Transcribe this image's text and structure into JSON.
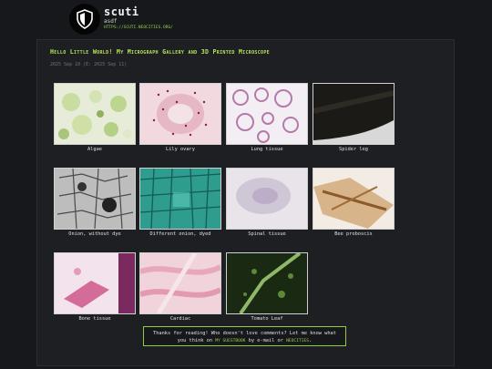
{
  "header": {
    "title": "scuti",
    "subtitle": "asdf",
    "url": "HTTPS://SCUTI.NEOCITIES.ORG/",
    "logo_icon": "shield-logo-icon"
  },
  "post": {
    "title": "Hello Little World! My Micrograph Gallery and 3D Printed Microscope",
    "date": "2025 Sep 10 (E: 2025 Sep 11)"
  },
  "gallery": [
    {
      "caption": "Algae",
      "image": "algae"
    },
    {
      "caption": "Lily ovary",
      "image": "lily-ovary"
    },
    {
      "caption": "Lung tissue",
      "image": "lung-tissue"
    },
    {
      "caption": "Spider leg",
      "image": "spider-leg"
    },
    {
      "caption": "Onion, without dye",
      "image": "onion-plain"
    },
    {
      "caption": "Different onion, dyed",
      "image": "onion-dyed"
    },
    {
      "caption": "Spinal tissue",
      "image": "spinal-tissue"
    },
    {
      "caption": "Bee proboscis",
      "image": "bee-proboscis"
    },
    {
      "caption": "Bone tissue",
      "image": "bone-tissue"
    },
    {
      "caption": "Cardiac",
      "image": "cardiac"
    },
    {
      "caption": "Tomato Leaf",
      "image": "tomato-leaf"
    }
  ],
  "footer": {
    "line1": "Thanks for reading! Who doesn't love comments? Let me know what",
    "line2_pre": "you think on",
    "guestbook_link": "MY GUESTBOOK",
    "line2_mid": "by e-mail or",
    "neocities_link": "NEOCITIES",
    "line2_end": "."
  },
  "colors": {
    "background": "#16181b",
    "panel": "#1d1f22",
    "accent_green": "#b6e45a",
    "footer_border": "#8ed03b"
  }
}
